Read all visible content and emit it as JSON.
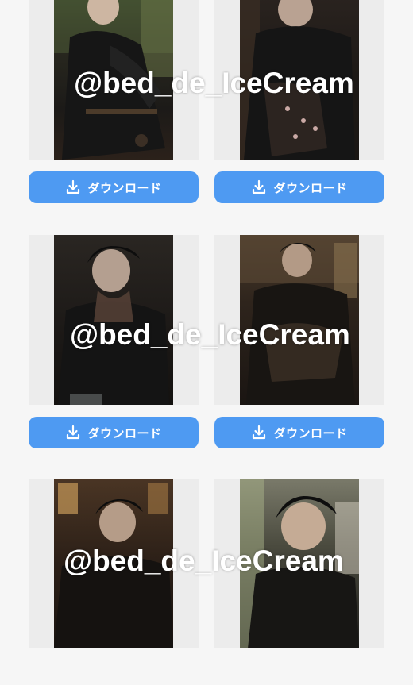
{
  "download_label": "ダウンロード",
  "watermark_text": "@bed_de_IceCream",
  "colors": {
    "page_background": "#f6f6f6",
    "thumb_frame": "#ececec",
    "button_accent": "#4e9af2",
    "button_text": "#ffffff"
  },
  "icons": {
    "download": "download-icon"
  }
}
